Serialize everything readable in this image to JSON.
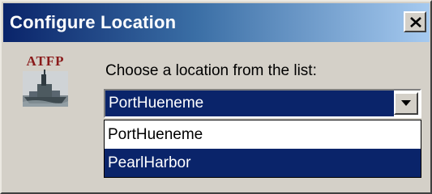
{
  "window": {
    "title": "Configure Location"
  },
  "logo": {
    "text": "ATFP",
    "icon": "ship-icon"
  },
  "prompt": {
    "text": "Choose a location from the list:"
  },
  "location_select": {
    "selected": "PortHueneme",
    "options": [
      "PortHueneme",
      "PearlHarbor"
    ],
    "highlighted_option": "PearlHarbor"
  },
  "colors": {
    "titlebar_start": "#0a246a",
    "titlebar_end": "#a6caf0",
    "selection": "#0a246a",
    "dialog_bg": "#d4d0c8"
  }
}
